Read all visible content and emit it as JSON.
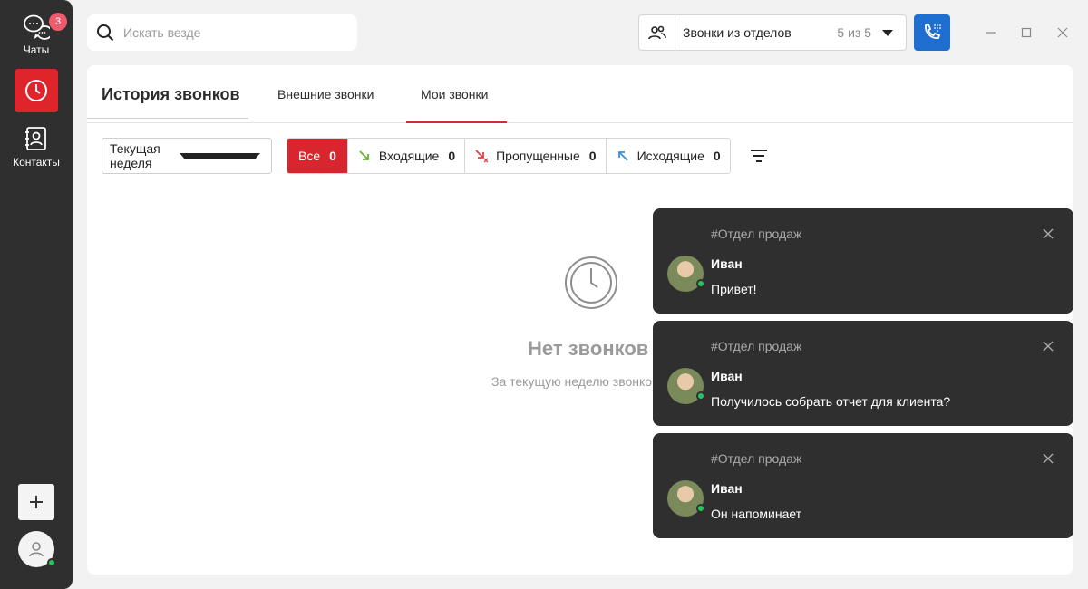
{
  "sidebar": {
    "chats_label": "Чаты",
    "chats_badge": "3",
    "contacts_label": "Контакты"
  },
  "search": {
    "placeholder": "Искать везде"
  },
  "departments": {
    "label": "Звонки из отделов",
    "count": "5 из 5"
  },
  "main": {
    "title": "История звонков",
    "tabs": [
      {
        "label": "Внешние звонки"
      },
      {
        "label": "Мои звонки",
        "active": true
      }
    ],
    "period": "Текущая неделя",
    "filters": [
      {
        "label": "Все",
        "count": "0",
        "active": true
      },
      {
        "label": "Входящие",
        "count": "0"
      },
      {
        "label": "Пропущенные",
        "count": "0"
      },
      {
        "label": "Исходящие",
        "count": "0"
      }
    ],
    "empty": {
      "title": "Нет звонков",
      "subtitle": "За текущую неделю звонков"
    }
  },
  "notifications": [
    {
      "channel": "#Отдел продаж",
      "name": "Иван",
      "text": "Привет!"
    },
    {
      "channel": "#Отдел продаж",
      "name": "Иван",
      "text": "Получилось собрать отчет для клиента?"
    },
    {
      "channel": "#Отдел продаж",
      "name": "Иван",
      "text": "Он напоминает"
    }
  ],
  "colors": {
    "sidebar": "#2f2f2f",
    "accent_red": "#d9262e",
    "call_blue": "#1f6fd1",
    "online": "#22c55e",
    "incoming": "#5cb82a",
    "missed": "#e0424a",
    "outgoing": "#3b8fd6"
  }
}
